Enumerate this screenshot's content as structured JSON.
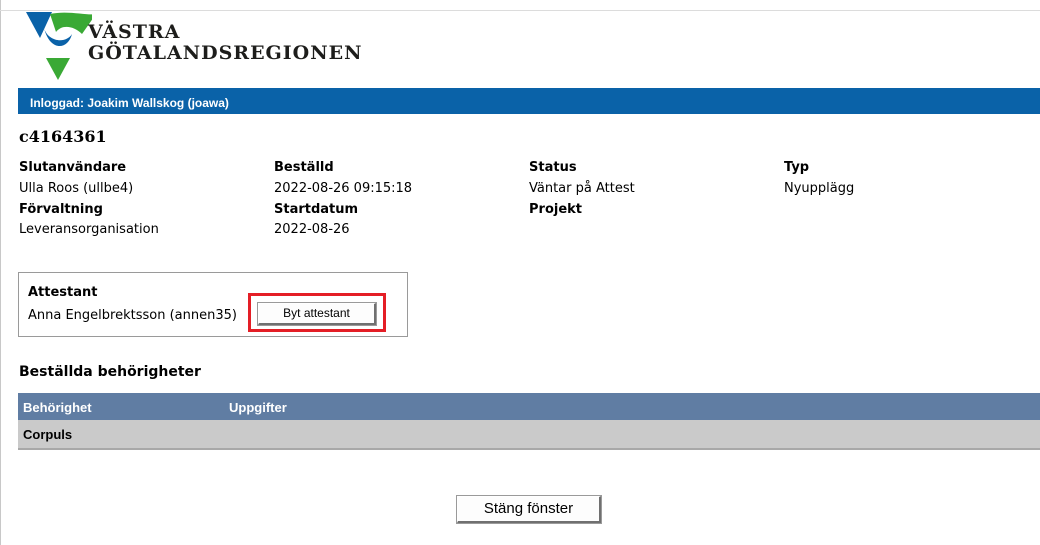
{
  "logo": {
    "line1": "VÄSTRA",
    "line2": "GÖTALANDSREGIONEN",
    "colors": [
      "#0a62a8",
      "#3aa935"
    ]
  },
  "topbar": {
    "logged_in": "Inloggad: Joakim Wallskog (joawa)"
  },
  "order": {
    "id": "c4164361",
    "fields": {
      "slutanvandare_label": "Slutanvändare",
      "slutanvandare_value": "Ulla Roos (ullbe4)",
      "forvaltning_label": "Förvaltning",
      "forvaltning_value": "Leveransorganisation",
      "bestalld_label": "Beställd",
      "bestalld_value": "2022-08-26 09:15:18",
      "startdatum_label": "Startdatum",
      "startdatum_value": "2022-08-26",
      "status_label": "Status",
      "status_value": "Väntar på Attest",
      "projekt_label": "Projekt",
      "typ_label": "Typ",
      "typ_value": "Nyupplägg"
    }
  },
  "attest": {
    "title": "Attestant",
    "name": "Anna Engelbrektsson (annen35)",
    "button_label": "Byt attestant",
    "highlight_color": "#e41e26"
  },
  "permissions": {
    "title": "Beställda behörigheter",
    "columns": [
      "Behörighet",
      "Uppgifter"
    ],
    "rows": [
      [
        "Corpuls",
        ""
      ]
    ],
    "header_color": "#607da3"
  },
  "footer": {
    "close_label": "Stäng fönster"
  }
}
